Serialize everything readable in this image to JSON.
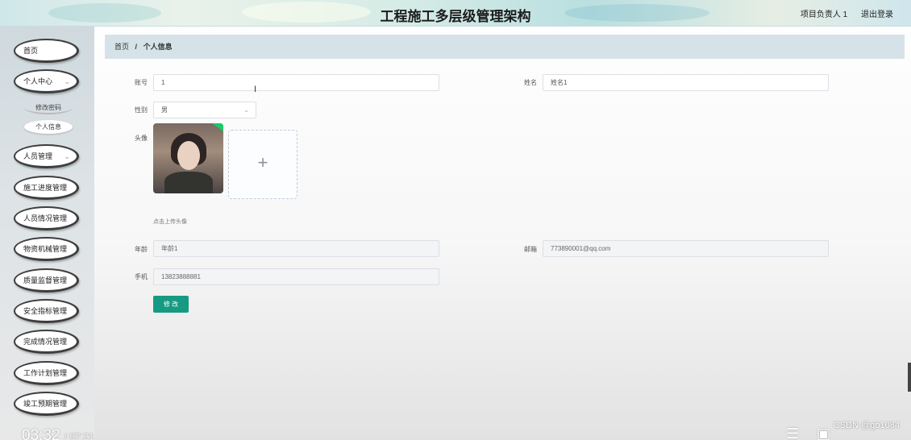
{
  "header": {
    "title": "工程施工多层级管理架构",
    "user_label": "项目负责人 1",
    "logout_label": "退出登录"
  },
  "sidebar": {
    "items": [
      {
        "label": "首页"
      },
      {
        "label": "个人中心",
        "expandable": true
      },
      {
        "label": "人员管理",
        "expandable": true
      },
      {
        "label": "施工进度管理"
      },
      {
        "label": "人员情况管理"
      },
      {
        "label": "物资机械管理"
      },
      {
        "label": "质量监督管理"
      },
      {
        "label": "安全指标管理"
      },
      {
        "label": "完成情况管理"
      },
      {
        "label": "工作计划管理"
      },
      {
        "label": "竣工预期管理"
      }
    ],
    "sub_items": [
      {
        "label": "修改密码"
      },
      {
        "label": "个人信息",
        "active": true
      }
    ],
    "chevron_icon": "chevron-down-icon"
  },
  "breadcrumb": {
    "home": "首页",
    "separator": "/",
    "current": "个人信息"
  },
  "form": {
    "account_label": "账号",
    "account_value": "1",
    "name_label": "姓名",
    "name_value": "姓名1",
    "gender_label": "性别",
    "gender_value": "男",
    "avatar_label": "头像",
    "upload_plus": "+",
    "upload_hint": "点击上传头像",
    "age_label": "年龄",
    "age_value": "年龄1",
    "email_label": "邮箱",
    "email_value": "773890001@qq.com",
    "phone_label": "手机",
    "phone_value": "13823888881",
    "submit_label": "修 改"
  },
  "overlay": {
    "time_current": "03:32",
    "time_total": "/ 07:21",
    "watermark": "CSDN @gb1084"
  },
  "colors": {
    "primary": "#169a82",
    "breadcrumb_bg": "#d5e3e8"
  }
}
